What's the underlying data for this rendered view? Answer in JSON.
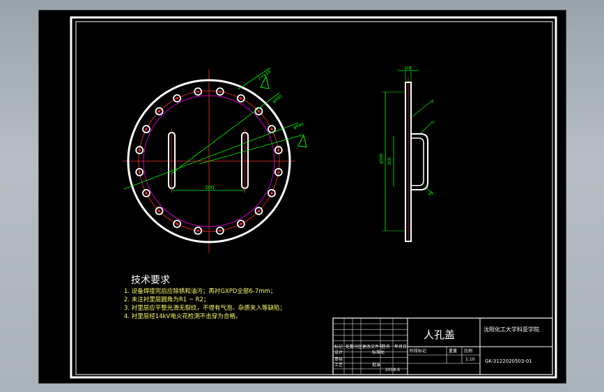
{
  "drawing": {
    "front_view_labels": {
      "bolt_hole_note": "2×φ18",
      "pcd_label": "φ490",
      "angle_label": "φ440",
      "slot_span_label": "300",
      "hatch_note": "A"
    },
    "side_view_labels": {
      "top_dim": "18",
      "left_dim": "φ580",
      "inner_dim": "300",
      "callout_1": "8",
      "callout_2": "2",
      "callout_3": "R5"
    },
    "tech_requirements": {
      "title": "技术要求",
      "items": [
        "1. 设备焊接完后应除锈和油污；再衬GXPD全部6-7mm；",
        "2. 未注衬里层圆角为R1 ~ R2；",
        "3. 衬里层应平整光滑无裂纹，不得有气泡、杂质夹入等缺陷；",
        "4. 衬里层经14kV电火花检测不击穿为合格。"
      ]
    },
    "title_block": {
      "part_name": "人孔盖",
      "school": "沈阳化工大学科亚学院",
      "drawing_no": "GK-3122020503-01",
      "scale": "1:10",
      "date": "2018.6",
      "headers": [
        "标记",
        "处数",
        "分区",
        "更改文件号",
        "签名",
        "年月日"
      ],
      "row_labels": [
        "设计",
        "审核",
        "工艺",
        "标准化",
        "批准"
      ],
      "stage_labels": [
        "阶段标记",
        "重量",
        "比例"
      ]
    },
    "colors": {
      "frame": "#ffffff",
      "outline": "#ffffff",
      "centerline": "#ff3030",
      "dimension": "#00ff00",
      "hole_ring": "#ff00ff",
      "text_yellow": "#ffff66"
    }
  }
}
